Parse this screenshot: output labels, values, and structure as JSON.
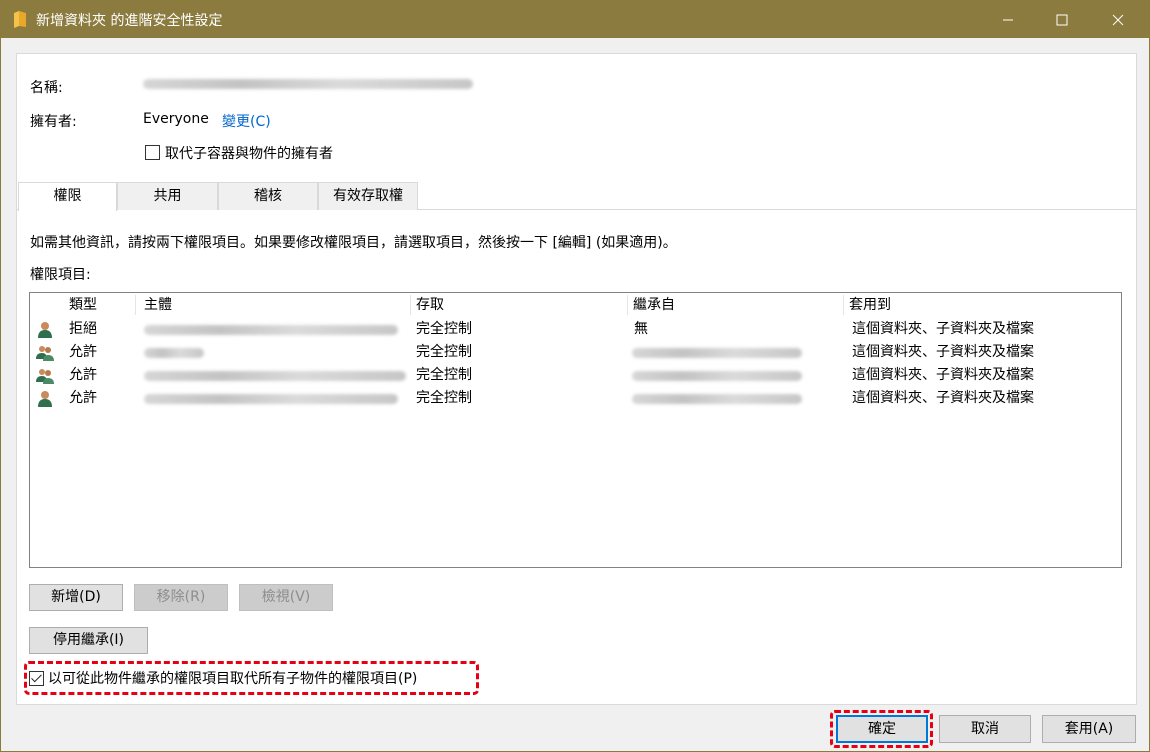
{
  "window": {
    "title": "新增資料夾 的進階安全性設定",
    "accent_color": "#8b7b3e"
  },
  "header": {
    "name_label": "名稱:",
    "owner_label": "擁有者:",
    "owner_value": "Everyone",
    "change_link": "變更(C)",
    "replace_owner_checkbox": "取代子容器與物件的擁有者",
    "replace_owner_checked": false
  },
  "tabs": [
    {
      "label": "權限",
      "active": true
    },
    {
      "label": "共用",
      "active": false
    },
    {
      "label": "稽核",
      "active": false
    },
    {
      "label": "有效存取權",
      "active": false
    }
  ],
  "info_text": "如需其他資訊，請按兩下權限項目。如果要修改權限項目，請選取項目，然後按一下 [編輯] (如果適用)。",
  "entries_label": "權限項目:",
  "table": {
    "columns": [
      "類型",
      "主體",
      "存取",
      "繼承自",
      "套用到"
    ],
    "rows": [
      {
        "icon": "single-user-icon",
        "type": "拒絕",
        "access": "完全控制",
        "inherited": "無",
        "applies": "這個資料夾、子資料夾及檔案"
      },
      {
        "icon": "user-group-icon",
        "type": "允許",
        "access": "完全控制",
        "inherited": "",
        "applies": "這個資料夾、子資料夾及檔案"
      },
      {
        "icon": "user-group-icon",
        "type": "允許",
        "access": "完全控制",
        "inherited": "",
        "applies": "這個資料夾、子資料夾及檔案"
      },
      {
        "icon": "single-user-icon",
        "type": "允許",
        "access": "完全控制",
        "inherited": "",
        "applies": "這個資料夾、子資料夾及檔案"
      }
    ]
  },
  "buttons": {
    "add": "新增(D)",
    "remove": "移除(R)",
    "view": "檢視(V)",
    "disable_inheritance": "停用繼承(I)",
    "replace_all_checkbox": "以可從此物件繼承的權限項目取代所有子物件的權限項目(P)",
    "replace_all_checked": true,
    "ok": "確定",
    "cancel": "取消",
    "apply": "套用(A)"
  },
  "highlight_color": "#e60012"
}
